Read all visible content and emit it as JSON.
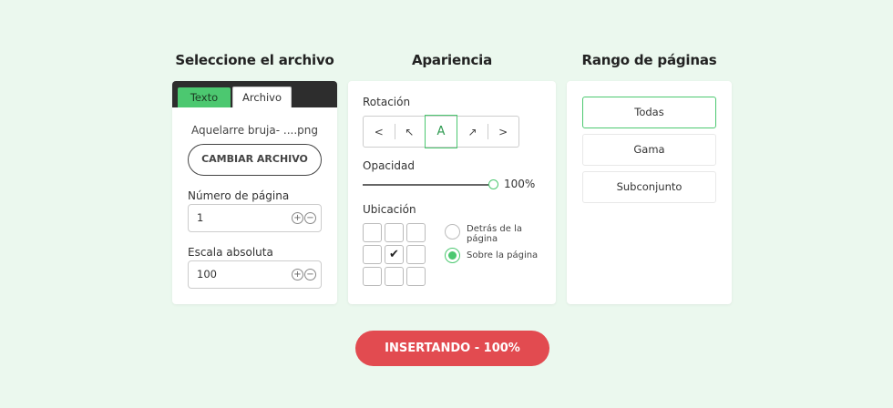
{
  "columns": {
    "file_title": "Seleccione el archivo",
    "appearance_title": "Apariencia",
    "range_title": "Rango de páginas"
  },
  "file": {
    "tabs": [
      "Texto",
      "Archivo"
    ],
    "active_tab": "Archivo",
    "filename": "Aquelarre bruja- ....png",
    "change_button": "CAMBIAR ARCHIVO",
    "page_number_label": "Número de página",
    "page_number_value": "1",
    "scale_label": "Escala absoluta",
    "scale_value": "100",
    "stepper": {
      "plus": "+",
      "minus": "−"
    }
  },
  "appearance": {
    "rotation_label": "Rotación",
    "rotation_options": [
      "<",
      "↖",
      "A",
      "↗",
      ">"
    ],
    "rotation_selected": "A",
    "opacity_label": "Opacidad",
    "opacity_value": "100%",
    "opacity_fraction": 1.0,
    "location_label": "Ubicación",
    "grid_selected_cell": "middle-center",
    "grid_check_glyph": "✔",
    "position_options": [
      "Detrás de la página",
      "Sobre la página"
    ],
    "position_selected": "Sobre la página"
  },
  "range": {
    "options": [
      "Todas",
      "Gama",
      "Subconjunto"
    ],
    "selected": "Todas"
  },
  "insert_button": "INSERTANDO - 100%",
  "colors": {
    "accent_green": "#4cc870",
    "button_red": "#e24b50",
    "background": "#ebf8ee",
    "tabbar_dark": "#2d2d2d"
  }
}
